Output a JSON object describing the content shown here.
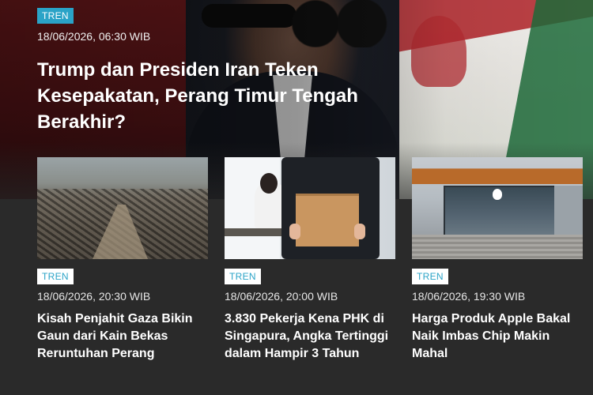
{
  "hero": {
    "tag": "TREN",
    "date": "18/06/2026, 06:30 WIB",
    "title": "Trump dan Presiden Iran Teken Kesepakatan, Perang Timur Tengah Berakhir?"
  },
  "cards": [
    {
      "tag": "TREN",
      "date": "18/06/2026, 20:30 WIB",
      "title": "Kisah Penjahit Gaza Bikin Gaun dari Kain Bekas Reruntuhan Perang"
    },
    {
      "tag": "TREN",
      "date": "18/06/2026, 20:00 WIB",
      "title": "3.830 Pekerja Kena PHK di Singapura, Angka Tertinggi dalam Hampir 3 Tahun"
    },
    {
      "tag": "TREN",
      "date": "18/06/2026, 19:30 WIB",
      "title": "Harga Produk Apple Bakal Naik Imbas Chip Makin Mahal"
    }
  ],
  "colors": {
    "tag_accent": "#2aa3c7",
    "background": "#2a2a2a"
  }
}
